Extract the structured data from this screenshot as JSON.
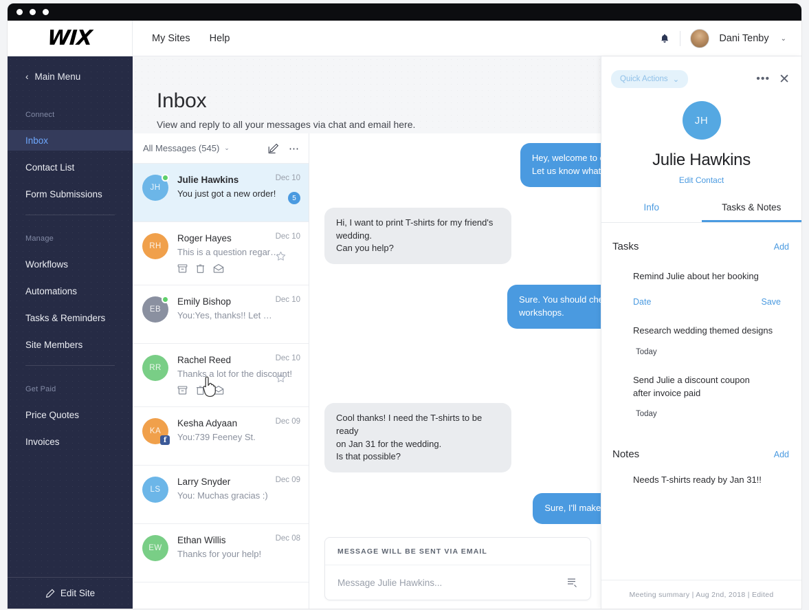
{
  "window": {
    "title_dots": 3
  },
  "topnav": {
    "logo": "WIX",
    "links": [
      {
        "label": "My Sites",
        "name": "nav-my-sites"
      },
      {
        "label": "Help",
        "name": "nav-help"
      }
    ],
    "bell_icon": "bell-icon",
    "user": {
      "name": "Dani Tenby",
      "caret": "⌄"
    }
  },
  "sidebar": {
    "back_label": "Main Menu",
    "back_chevron": "‹",
    "groups": [
      {
        "title": "Connect",
        "items": [
          {
            "label": "Inbox",
            "active": true
          },
          {
            "label": "Contact List",
            "active": false
          },
          {
            "label": "Form Submissions",
            "active": false
          }
        ]
      },
      {
        "title": "Manage",
        "items": [
          {
            "label": "Workflows",
            "active": false
          },
          {
            "label": "Automations",
            "active": false
          },
          {
            "label": "Tasks & Reminders",
            "active": false
          },
          {
            "label": "Site Members",
            "active": false
          }
        ]
      },
      {
        "title": "Get Paid",
        "items": [
          {
            "label": "Price Quotes",
            "active": false
          },
          {
            "label": "Invoices",
            "active": false
          }
        ]
      }
    ],
    "edit_site": {
      "label": "Edit Site",
      "icon": "pencil-icon"
    }
  },
  "inbox": {
    "title": "Inbox",
    "subtitle": "View and reply to all your messages via chat and email here.",
    "toolbar": {
      "filter_label": "All Messages (545)",
      "filter_caret": "⌄",
      "compose_icon": "compose-icon",
      "more_icon": "more-icon"
    },
    "rows": [
      {
        "initials": "JH",
        "name": "Julie Hawkins",
        "preview": "You just got a new order!",
        "date": "Dec 10",
        "avatar_color": "#6cb6e8",
        "selected": true,
        "online": true,
        "unread_count": "5",
        "starred": false,
        "show_actions": false,
        "facebook": false,
        "unread": true
      },
      {
        "initials": "RH",
        "name": "Roger Hayes",
        "preview": "This is a question regar…",
        "date": "Dec 10",
        "avatar_color": "#f0a04b",
        "selected": false,
        "online": false,
        "unread_count": "",
        "starred": true,
        "show_actions": true,
        "facebook": false,
        "unread": false
      },
      {
        "initials": "EB",
        "name": "Emily Bishop",
        "preview": "You:Yes, thanks!! Let …",
        "date": "Dec 10",
        "avatar_color": "#8a90a0",
        "selected": false,
        "online": true,
        "unread_count": "",
        "starred": false,
        "show_actions": false,
        "facebook": false,
        "unread": false
      },
      {
        "initials": "RR",
        "name": "Rachel Reed",
        "preview": "Thanks a lot for the discount!",
        "date": "Dec 10",
        "avatar_color": "#79ce86",
        "selected": false,
        "online": false,
        "unread_count": "",
        "starred": true,
        "show_actions": true,
        "facebook": false,
        "unread": false
      },
      {
        "initials": "KA",
        "name": "Kesha Adyaan",
        "preview": "You:739 Feeney St.",
        "date": "Dec 09",
        "avatar_color": "#f0a04b",
        "selected": false,
        "online": false,
        "unread_count": "",
        "starred": false,
        "show_actions": false,
        "facebook": true,
        "unread": false
      },
      {
        "initials": "LS",
        "name": "Larry Snyder",
        "preview": "You: Muchas gracias :)",
        "date": "Dec 09",
        "avatar_color": "#6cb6e8",
        "selected": false,
        "online": false,
        "unread_count": "",
        "starred": false,
        "show_actions": false,
        "facebook": false,
        "unread": false
      },
      {
        "initials": "EW",
        "name": "Ethan Willis",
        "preview": "Thanks for your help!",
        "date": "Dec 08",
        "avatar_color": "#79ce86",
        "selected": false,
        "online": false,
        "unread_count": "",
        "starred": false,
        "show_actions": false,
        "facebook": false,
        "unread": false
      }
    ]
  },
  "chat": {
    "messages": [
      {
        "dir": "out",
        "text": "Hey, welcome to our store!\nLet us know what you need."
      },
      {
        "dir": "in",
        "text": "Hi, I want to print T-shirts for my friend's wedding.\nCan you help?"
      },
      {
        "dir": "out",
        "text": "Sure. You should check out our\nworkshops."
      },
      {
        "dir": "in",
        "text": "Cool thanks! I need the T-shirts to be ready\non Jan 31 for the wedding.\nIs that possible?"
      },
      {
        "dir": "out",
        "text": "Sure, I'll make it happen."
      }
    ],
    "composer": {
      "banner": "MESSAGE WILL BE SENT VIA EMAIL",
      "placeholder": "Message Julie Hawkins...",
      "value": "",
      "icon": "saved-replies-icon"
    }
  },
  "contact_panel": {
    "quick_actions": {
      "label": "Quick Actions",
      "caret": "⌄"
    },
    "more_icon": "•••",
    "close_icon": "✕",
    "avatar_initials": "JH",
    "avatar_color": "#55a8e2",
    "name": "Julie Hawkins",
    "edit_contact": "Edit Contact",
    "tabs": [
      {
        "label": "Info",
        "active": false
      },
      {
        "label": "Tasks & Notes",
        "active": true
      }
    ],
    "tasks": {
      "title": "Tasks",
      "add_label": "Add",
      "items": [
        {
          "text": "Remind Julie about her booking",
          "date_link": "Date",
          "save_link": "Save",
          "editing": true,
          "when": ""
        },
        {
          "text": "Research wedding themed designs",
          "date_link": "",
          "save_link": "",
          "editing": false,
          "when": "Today"
        },
        {
          "text": "Send Julie a discount coupon\nafter invoice paid",
          "date_link": "",
          "save_link": "",
          "editing": false,
          "when": "Today"
        }
      ]
    },
    "notes": {
      "title": "Notes",
      "add_label": "Add",
      "items": [
        {
          "text": "Needs T-shirts ready by Jan 31!!"
        }
      ]
    },
    "footer": "Meeting summary | Aug 2nd, 2018 | Edited"
  },
  "colors": {
    "accent_blue": "#4a9ae0",
    "sidebar_bg": "#262b45",
    "selected_row": "#e4f2fb"
  }
}
